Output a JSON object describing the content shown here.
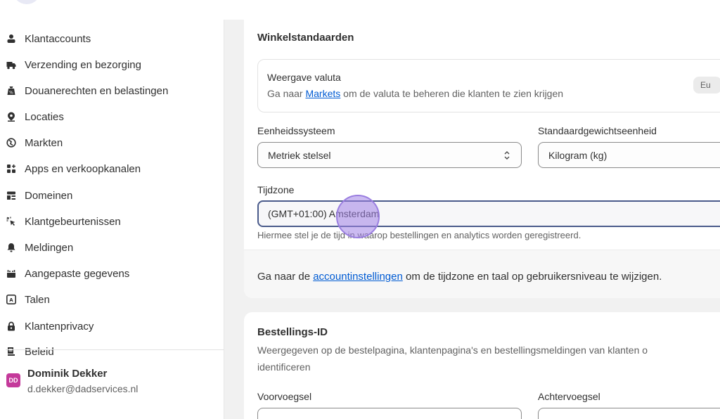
{
  "sidebar": {
    "items": [
      {
        "label": "Klantaccounts",
        "icon": "person-icon"
      },
      {
        "label": "Verzending en bezorging",
        "icon": "truck-icon"
      },
      {
        "label": "Douanerechten en belastingen",
        "icon": "tax-bag-icon"
      },
      {
        "label": "Locaties",
        "icon": "location-pin-icon"
      },
      {
        "label": "Markten",
        "icon": "globe-icon"
      },
      {
        "label": "Apps en verkoopkanalen",
        "icon": "apps-icon"
      },
      {
        "label": "Domeinen",
        "icon": "domain-icon"
      },
      {
        "label": "Klantgebeurtenissen",
        "icon": "cursor-click-icon"
      },
      {
        "label": "Meldingen",
        "icon": "bell-icon"
      },
      {
        "label": "Aangepaste gegevens",
        "icon": "custom-data-icon"
      },
      {
        "label": "Talen",
        "icon": "language-icon"
      },
      {
        "label": "Klantenprivacy",
        "icon": "lock-icon"
      },
      {
        "label": "Beleid",
        "icon": "policy-icon"
      }
    ],
    "user": {
      "initials": "DD",
      "name": "Dominik Dekker",
      "email": "d.dekker@dadservices.nl"
    }
  },
  "store_defaults": {
    "title": "Winkelstandaarden",
    "currency": {
      "title": "Weergave valuta",
      "sub_prefix": "Ga naar ",
      "sub_link": "Markets",
      "sub_suffix": " om de valuta te beheren die klanten te zien krijgen",
      "badge": "Eu"
    },
    "unit_system": {
      "label": "Eenheidssysteem",
      "value": "Metriek stelsel"
    },
    "weight_unit": {
      "label": "Standaardgewichtseenheid",
      "value": "Kilogram (kg)"
    },
    "timezone": {
      "label": "Tijdzone",
      "value": "(GMT+01:00) Amsterdam",
      "help": "Hiermee stel je de tijd in waarop bestellingen en analytics worden geregistreerd."
    },
    "footer": {
      "prefix": "Ga naar de ",
      "link": "accountinstellingen",
      "suffix": " om de tijdzone en taal op gebruikersniveau te wijzigen."
    }
  },
  "order_id": {
    "title": "Bestellings-ID",
    "desc_line1": "Weergegeven op de bestelpagina, klantenpagina's en bestellingsmeldingen van klanten o",
    "desc_line2": "identificeren",
    "prefix_label": "Voorvoegsel",
    "suffix_label": "Achtervoegsel"
  },
  "colors": {
    "link": "#005bd3",
    "avatar": "#c4399a",
    "focus_border": "#4a5b8b",
    "cursor_highlight": "#9a7ee0"
  }
}
